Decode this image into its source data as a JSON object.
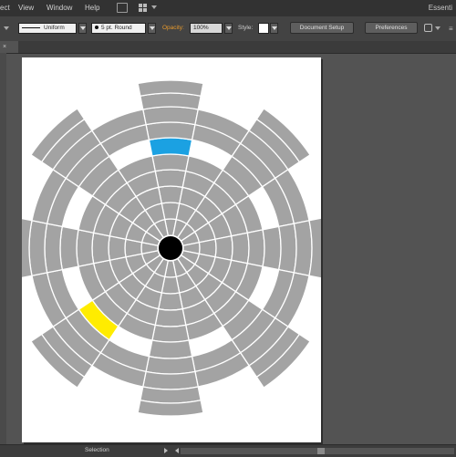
{
  "menubar": {
    "items": [
      "ect",
      "View",
      "Window",
      "Help"
    ],
    "workspace": "Essenti"
  },
  "controlbar": {
    "stroke_profile": "Uniform",
    "brush": "5 pt. Round",
    "opacity_label": "Opacity:",
    "opacity_value": "100%",
    "style_label": "Style:",
    "document_setup": "Document Setup",
    "preferences": "Preferences"
  },
  "statusbar": {
    "mode": "Selection"
  },
  "artwork": {
    "ring_color": "#a3a3a3",
    "highlight_colors": {
      "cyan": "#1ba1e2",
      "magenta": "#e3007d",
      "yellow": "#ffec00"
    },
    "center_color": "#000000"
  }
}
